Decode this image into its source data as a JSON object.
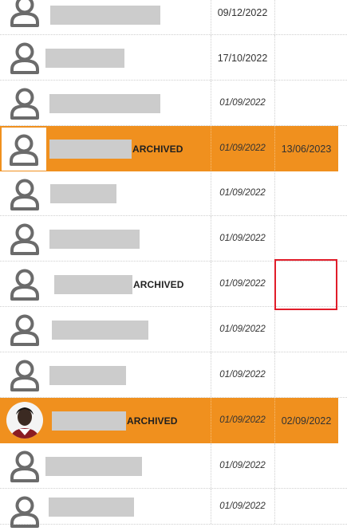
{
  "rows": [
    {
      "date1": "09/12/2022",
      "date1_italic": false,
      "date2": "",
      "highlight": false,
      "name_suffix": "",
      "avatar": "person-icon"
    },
    {
      "date1": "17/10/2022",
      "date1_italic": false,
      "date2": "",
      "highlight": false,
      "name_suffix": "",
      "avatar": "person-icon"
    },
    {
      "date1": "01/09/2022",
      "date1_italic": true,
      "date2": "",
      "highlight": false,
      "name_suffix": "",
      "avatar": "person-icon"
    },
    {
      "date1": "01/09/2022",
      "date1_italic": true,
      "date2": "13/06/2023",
      "highlight": true,
      "name_suffix": "ARCHIVED",
      "avatar": "person-icon"
    },
    {
      "date1": "01/09/2022",
      "date1_italic": true,
      "date2": "",
      "highlight": false,
      "name_suffix": "",
      "avatar": "person-icon"
    },
    {
      "date1": "01/09/2022",
      "date1_italic": true,
      "date2": "",
      "highlight": false,
      "name_suffix": "",
      "avatar": "person-icon"
    },
    {
      "date1": "01/09/2022",
      "date1_italic": true,
      "date2": "",
      "highlight": false,
      "name_suffix": "ARCHIVED",
      "avatar": "person-icon"
    },
    {
      "date1": "01/09/2022",
      "date1_italic": true,
      "date2": "",
      "highlight": false,
      "name_suffix": "",
      "avatar": "person-icon"
    },
    {
      "date1": "01/09/2022",
      "date1_italic": true,
      "date2": "",
      "highlight": false,
      "name_suffix": "",
      "avatar": "person-icon"
    },
    {
      "date1": "01/09/2022",
      "date1_italic": true,
      "date2": "02/09/2022",
      "highlight": true,
      "name_suffix": "ARCHIVED",
      "avatar": "profile-photo"
    },
    {
      "date1": "01/09/2022",
      "date1_italic": true,
      "date2": "",
      "highlight": false,
      "name_suffix": "",
      "avatar": "person-icon"
    },
    {
      "date1": "01/09/2022",
      "date1_italic": true,
      "date2": "",
      "highlight": false,
      "name_suffix": "",
      "avatar": "person-icon"
    }
  ],
  "colors": {
    "highlight": "#f0901e",
    "redaction": "#cccccc",
    "focus_outline": "#e11d2a",
    "icon": "#6b6b6b"
  }
}
